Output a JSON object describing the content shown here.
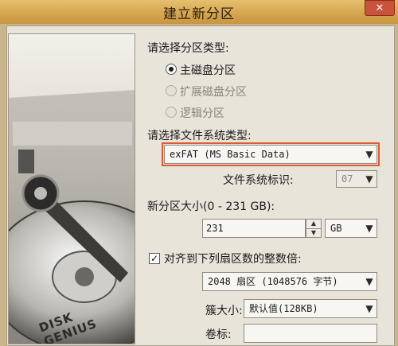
{
  "window": {
    "title": "建立新分区",
    "close_glyph": "✕"
  },
  "partition_type": {
    "label": "请选择分区类型:",
    "options": [
      {
        "label": "主磁盘分区",
        "selected": true,
        "enabled": true
      },
      {
        "label": "扩展磁盘分区",
        "selected": false,
        "enabled": false
      },
      {
        "label": "逻辑分区",
        "selected": false,
        "enabled": false
      }
    ]
  },
  "filesystem": {
    "label": "请选择文件系统类型:",
    "value": "exFAT (MS Basic Data)",
    "id_label": "文件系统标识:",
    "id_value": "07"
  },
  "size": {
    "label": "新分区大小(0 - 231 GB):",
    "value": "231",
    "unit": "GB"
  },
  "align": {
    "checked": true,
    "label": "对齐到下列扇区数的整数倍:",
    "value": "2048 扇区 (1048576 字节)"
  },
  "cluster": {
    "label": "簇大小:",
    "value": "默认值(128KB)"
  },
  "volume": {
    "label": "卷标:",
    "value": ""
  },
  "art": {
    "brand": "DISK GENIUS"
  },
  "colors": {
    "title_bar": "#d6a650",
    "highlight_outline": "#e05a2e",
    "panel": "#e8e4da"
  }
}
